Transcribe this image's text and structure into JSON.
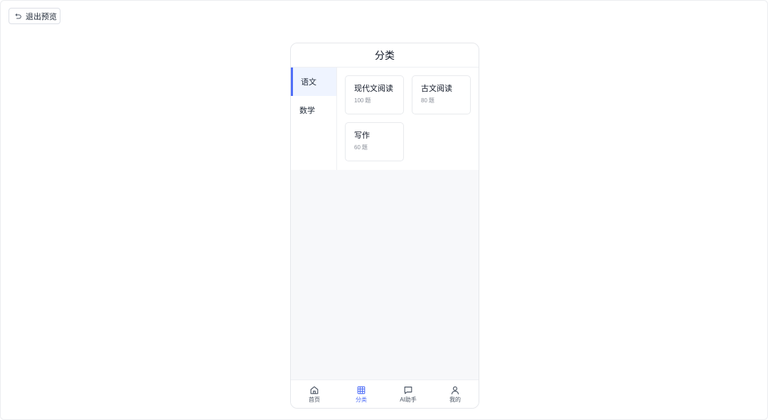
{
  "exit_button": {
    "label": "退出预览",
    "icon": "undo-icon"
  },
  "phone": {
    "title": "分类",
    "sidebar": {
      "items": [
        {
          "label": "语文",
          "active": true
        },
        {
          "label": "数学",
          "active": false
        }
      ]
    },
    "cards": [
      {
        "title": "现代文阅读",
        "count": "100",
        "unit": "题"
      },
      {
        "title": "古文阅读",
        "count": "80",
        "unit": "题"
      },
      {
        "title": "写作",
        "count": "60",
        "unit": "题"
      }
    ],
    "tabbar": {
      "tabs": [
        {
          "label": "首页",
          "icon": "home-icon",
          "active": false
        },
        {
          "label": "分类",
          "icon": "grid-icon",
          "active": true
        },
        {
          "label": "AI助手",
          "icon": "chat-icon",
          "active": false
        },
        {
          "label": "我的",
          "icon": "user-icon",
          "active": false
        }
      ]
    }
  },
  "colors": {
    "accent": "#4f6ef7",
    "active_bg": "#eff4ff",
    "page_bg": "#f7f8fa"
  }
}
